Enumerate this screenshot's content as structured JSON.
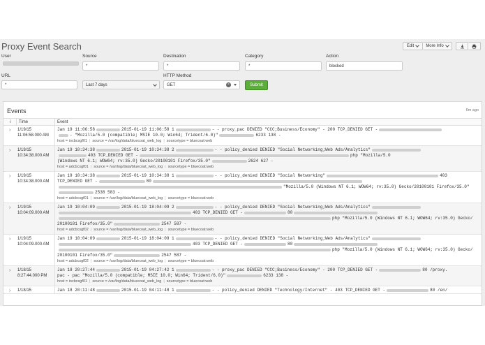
{
  "page": {
    "title": "Proxy Event Search",
    "edit_label": "Edit",
    "more_info_label": "More Info",
    "download_icon": "download-icon",
    "print_icon": "print-icon"
  },
  "form": {
    "user_label": "User",
    "source_label": "Source",
    "source_value": "*",
    "destination_label": "Destination",
    "destination_value": "*",
    "category_label": "Category",
    "category_value": "*",
    "action_label": "Action",
    "action_value": "blocked",
    "url_label": "URL",
    "url_value": "*",
    "time_value": "Last 7 days",
    "http_method_label": "HTTP Method",
    "http_method_value": "GET",
    "submit_label": "Submit"
  },
  "events": {
    "title": "Events",
    "age": "6m ago",
    "col_info": "i",
    "col_time": "Time",
    "col_event": "Event",
    "host_key": "host =",
    "source_key": "source =",
    "sourcetype_key": "sourcetype =",
    "rows": [
      {
        "date": "1/19/15",
        "time": "11:06:58.000 AM",
        "l1a": "Jan 19 11:06:58",
        "l1b": "2015-01-19 11:06:58 1",
        "l1c": "- - proxy_pac DENIED \"CCC;Business/Economy\" - 200 TCP_DENIED GET -",
        "l2a": "- \"Mozilla/5.0 (compatible; MSIE 10.0; Win64; Trident/6.0)\"",
        "l2b": "6233 138 -",
        "host": "iocbcsgf01",
        "source": "/var/log/data/bluecoat_web_log",
        "sourcetype": "bluecoat:web"
      },
      {
        "date": "1/19/15",
        "time": "10:34:38.000 AM",
        "l1a": "Jan 19 10:34:38",
        "l1b": "2015-01-19 10:34:38 2",
        "l1c": "- - policy_denied DENIED \"Social Networking;Web Ads/Analytics\"",
        "l2a": "403 TCP_DENIED GET -",
        "l2b": "php \"Mozilla/5.0",
        "l3a": "(Windows NT 6.1; WOW64; rv:35.0) Gecko/20100101 Firefox/35.0\"",
        "l3b": "2624 627 -",
        "host": "adcbcsgf01",
        "source": "/var/log/data/bluecoat_web_log",
        "sourcetype": "bluecoat:web"
      },
      {
        "date": "1/19/15",
        "time": "10:34:38.000 AM",
        "l1a": "Jan 19 10:34:38",
        "l1b": "2015-01-19 10:34:38 1",
        "l1c": "- - policy_denied DENIED \"Social Networking\"",
        "l1d": "403",
        "l2a": "TCP_DENIED GET -",
        "l2b": "80",
        "l3a": "\"Mozilla/5.0 (Windows NT 6.1; WOW64; rv:35.0) Gecko/20100101 Firefox/35.0\"",
        "l4a": "2538 583 -",
        "host": "adcbcsgf01",
        "source": "/var/log/data/bluecoat_web_log",
        "sourcetype": "bluecoat:web"
      },
      {
        "date": "1/19/15",
        "time": "10:04:09.000 AM",
        "l1a": "Jan 19 10:04:09",
        "l1b": "2015-01-19 18:04:09 2",
        "l1c": "- - policy_denied DENIED \"Social Networking;Web Ads/Analytics\"",
        "l2a": "403 TCP_DENIED GET -",
        "l2b": "80",
        "l3a": "php \"Mozilla/5.0 (Windows NT 6.1; WOW64; rv:35.0) Gecko/",
        "l4a": "20100101 Firefox/35.0\"",
        "l4b": "2547 587 -",
        "host": "adcbcsgf02",
        "source": "/var/log/data/bluecoat_web_log",
        "sourcetype": "bluecoat:web"
      },
      {
        "date": "1/19/15",
        "time": "10:04:09.000 AM",
        "l1a": "Jan 19 10:04:09",
        "l1b": "2015-01-19 18:04:09 1",
        "l1c": "- - policy_denied DENIED \"Social Networking;Web Ads/Analytics\"",
        "l2a": "403 TCP_DENIED GET -",
        "l2b": "80",
        "l3a": "php \"Mozilla/5.0 (Windows NT 6.1; WOW64; rv:35.0) Gecko/",
        "l4a": "20100101 Firefox/35.0\"",
        "l4b": "2547 587 -",
        "host": "adcbcsgf02",
        "source": "/var/log/data/bluecoat_web_log",
        "sourcetype": "bluecoat:web"
      },
      {
        "date": "1/18/15",
        "time": "8:27:44.000 PM",
        "l1a": "Jan 18 20:27:44",
        "l1b": "2015-01-19 04:27:42 1",
        "l1c": "- - proxy_pac DENIED \"CCC;Business/Economy\" - 200 TCP_DENIED GET -",
        "l1d": "80 /proxy.",
        "l2a": "pac - pac \"Mozilla/5.0 (compatible; MSIE 10.0; Win64; Trident/6.0)\"",
        "l2b": "6233 138 -",
        "host": "iocbcsgf01",
        "source": "/var/log/data/bluecoat_web_log",
        "sourcetype": "bluecoat:web"
      },
      {
        "date": "1/18/15",
        "time": "",
        "l1a": "Jan 18 20:11:48",
        "l1b": "2015-01-19 04:11:48 1",
        "l1c": "- - policy_denied DENIED \"Technology/Internet\" - 403 TCP_DENIED GET -",
        "l1d": "80 /en/"
      }
    ]
  }
}
